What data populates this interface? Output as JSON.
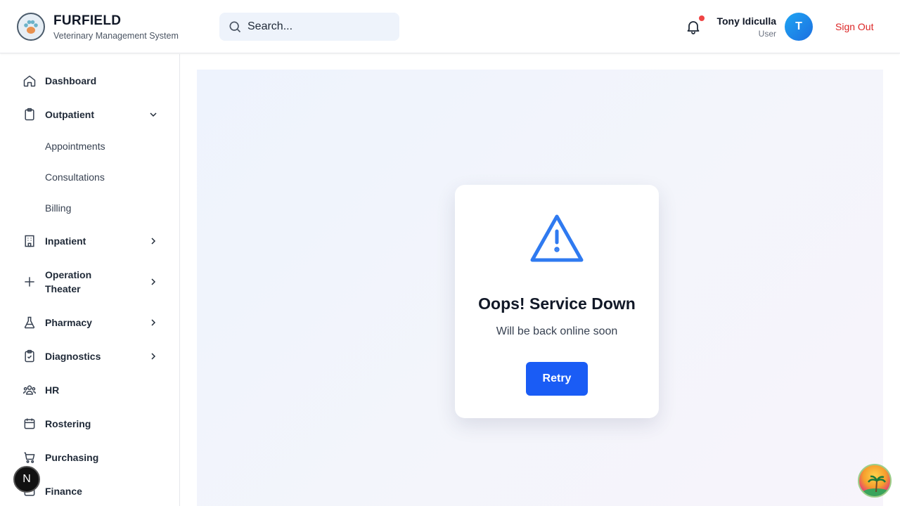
{
  "header": {
    "brand_title": "FURFIELD",
    "brand_subtitle": "Veterinary Management System",
    "search_placeholder": "Search...",
    "user_name": "Tony Idiculla",
    "user_role": "User",
    "avatar_initial": "T",
    "sign_out": "Sign Out"
  },
  "sidebar": {
    "items": [
      {
        "label": "Dashboard",
        "icon": "home-icon"
      },
      {
        "label": "Outpatient",
        "icon": "clipboard-icon",
        "expanded": true,
        "children": [
          "Appointments",
          "Consultations",
          "Billing"
        ]
      },
      {
        "label": "Inpatient",
        "icon": "building-icon"
      },
      {
        "label": "Operation Theater",
        "icon": "plus-icon"
      },
      {
        "label": "Pharmacy",
        "icon": "flask-icon"
      },
      {
        "label": "Diagnostics",
        "icon": "clipboard-check-icon"
      },
      {
        "label": "HR",
        "icon": "users-icon"
      },
      {
        "label": "Rostering",
        "icon": "calendar-icon"
      },
      {
        "label": "Purchasing",
        "icon": "cart-icon"
      },
      {
        "label": "Finance",
        "icon": "finance-icon"
      }
    ]
  },
  "error_card": {
    "title": "Oops! Service Down",
    "message": "Will be back online soon",
    "retry_label": "Retry"
  },
  "badges": {
    "dev_badge": "N"
  },
  "colors": {
    "accent": "#1a5cf5",
    "warning_icon": "#2f7af0",
    "sign_out": "#dc2626",
    "notification_dot": "#ef4444"
  }
}
